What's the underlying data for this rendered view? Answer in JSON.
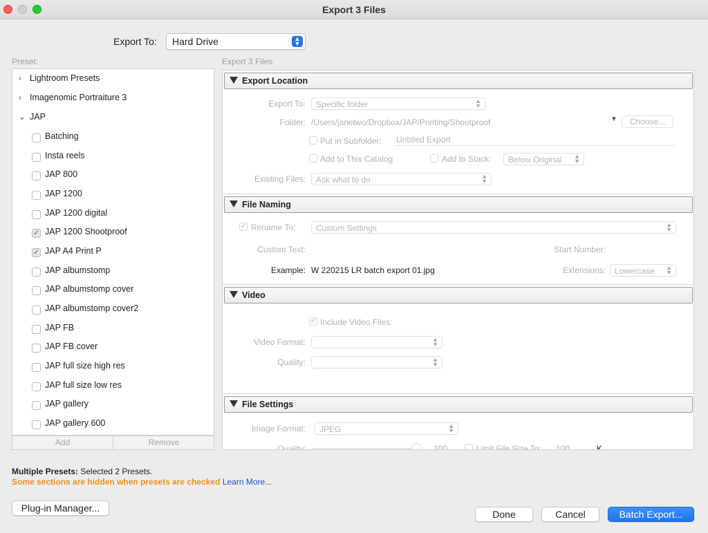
{
  "window": {
    "title": "Export 3 Files"
  },
  "export_to": {
    "label": "Export To:",
    "value": "Hard Drive"
  },
  "preset_panel": {
    "label": "Preset:",
    "folders": [
      {
        "label": "Lightroom Presets",
        "expanded": false
      },
      {
        "label": "Imagenomic Portraiture 3",
        "expanded": false
      },
      {
        "label": "JAP",
        "expanded": true
      }
    ],
    "items": [
      {
        "label": "Batching",
        "checked": false
      },
      {
        "label": "Insta reels",
        "checked": false
      },
      {
        "label": "JAP 800",
        "checked": false
      },
      {
        "label": "JAP 1200",
        "checked": false
      },
      {
        "label": "JAP 1200 digital",
        "checked": false
      },
      {
        "label": "JAP 1200 Shootproof",
        "checked": true
      },
      {
        "label": "JAP A4 Print P",
        "checked": true
      },
      {
        "label": "JAP albumstomp",
        "checked": false
      },
      {
        "label": "JAP albumstomp cover",
        "checked": false
      },
      {
        "label": "JAP albumstomp cover2",
        "checked": false
      },
      {
        "label": "JAP FB",
        "checked": false
      },
      {
        "label": "JAP FB cover",
        "checked": false
      },
      {
        "label": "JAP full size high res",
        "checked": false
      },
      {
        "label": "JAP full size low res",
        "checked": false
      },
      {
        "label": "JAP gallery",
        "checked": false
      },
      {
        "label": "JAP gallery 600",
        "checked": false
      }
    ],
    "add_label": "Add",
    "remove_label": "Remove"
  },
  "settings": {
    "caption": "Export 3 Files",
    "export_location": {
      "title": "Export Location",
      "export_to_label": "Export To:",
      "export_to_value": "Specific folder",
      "folder_label": "Folder:",
      "folder_path": "/Users/janetwo/Dropbox/JAP/Printing/Shootproof",
      "choose_label": "Choose...",
      "subfolder_label": "Put in Subfolder:",
      "subfolder_value": "Untitled Export",
      "add_catalog_label": "Add to This Catalog",
      "add_stack_label": "Add to Stack:",
      "stack_value": "Below Original",
      "existing_files_label": "Existing Files:",
      "existing_files_value": "Ask what to do"
    },
    "file_naming": {
      "title": "File Naming",
      "rename_label": "Rename To:",
      "rename_value": "Custom Settings",
      "custom_text_label": "Custom Text:",
      "start_number_label": "Start Number:",
      "example_label": "Example:",
      "example_value": "W 220215 LR batch export 01.jpg",
      "extensions_label": "Extensions:",
      "extensions_value": "Lowercase"
    },
    "video": {
      "title": "Video",
      "include_label": "Include Video Files:",
      "format_label": "Video Format:",
      "quality_label": "Quality:"
    },
    "file_settings": {
      "title": "File Settings",
      "image_format_label": "Image Format:",
      "image_format_value": "JPEG",
      "quality_label": "Quality:",
      "quality_value": "100",
      "limit_label": "Limit File Size To:",
      "limit_value": "100",
      "limit_unit": "K"
    }
  },
  "footer": {
    "multiple_presets_label": "Multiple Presets:",
    "multiple_presets_value": "Selected 2 Presets.",
    "warning": "Some sections are hidden when presets are checked",
    "learn_more": "Learn More...",
    "plugin_manager": "Plug-in Manager...",
    "done": "Done",
    "cancel": "Cancel",
    "batch_export": "Batch Export..."
  }
}
